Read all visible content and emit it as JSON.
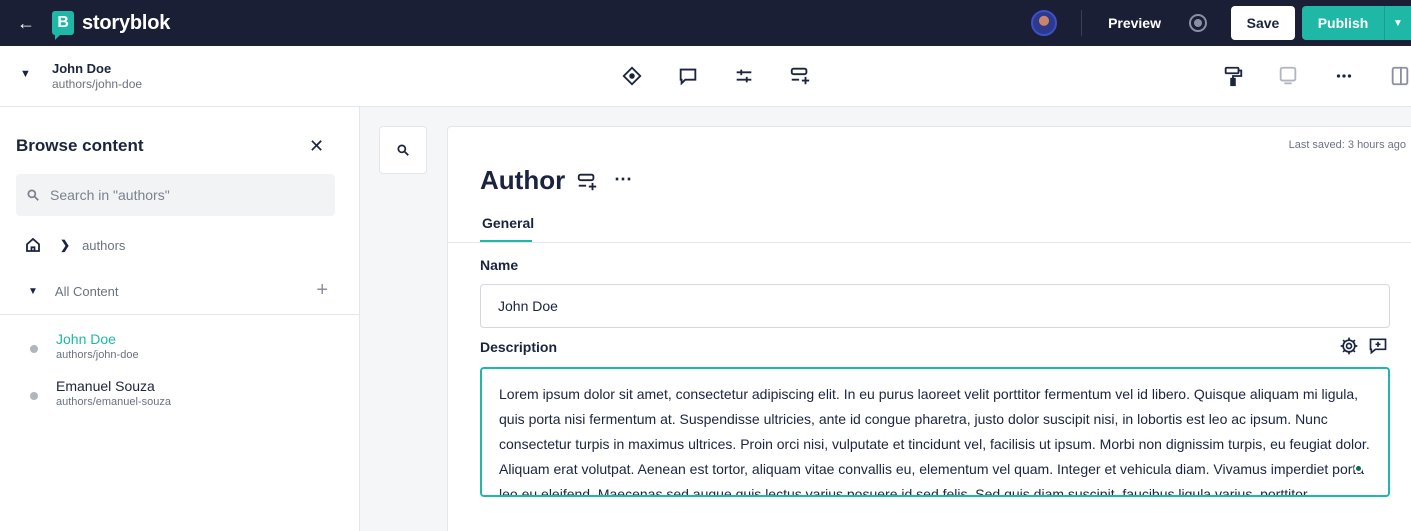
{
  "topbar": {
    "brand": "storyblok",
    "brand_mark": "B",
    "preview_label": "Preview",
    "save_label": "Save",
    "publish_label": "Publish",
    "accent": "#1fb8a6",
    "background": "#1b1f36"
  },
  "story": {
    "title": "John Doe",
    "slug": "authors/john-doe"
  },
  "toolbar_icons": [
    "entry-icon",
    "comments-icon",
    "settings-sliders-icon",
    "components-icon"
  ],
  "right_icons": [
    "paint-roller-icon",
    "device-preview-icon",
    "more-icon",
    "sidebar-toggle-icon"
  ],
  "sidebar": {
    "title": "Browse content",
    "search_placeholder": "Search in \"authors\"",
    "breadcrumb": "authors",
    "all_content_label": "All Content",
    "items": [
      {
        "title": "John Doe",
        "slug": "authors/john-doe",
        "active": true
      },
      {
        "title": "Emanuel Souza",
        "slug": "authors/emanuel-souza",
        "active": false
      }
    ]
  },
  "editor": {
    "last_saved": "Last saved: 3 hours ago",
    "component_title": "Author",
    "tab_general": "General",
    "name_label": "Name",
    "name_value": "John Doe",
    "description_label": "Description",
    "description_value": "Lorem ipsum dolor sit amet, consectetur adipiscing elit. In eu purus laoreet velit porttitor fermentum vel id libero. Quisque aliquam mi ligula, quis porta nisi fermentum at. Suspendisse ultricies, ante id congue pharetra, justo dolor suscipit nisi, in lobortis est leo ac ipsum. Nunc consectetur turpis in maximus ultrices. Proin orci nisi, vulputate et tincidunt vel, facilisis ut ipsum. Morbi non dignissim turpis, eu feugiat dolor. Aliquam erat volutpat. Aenean est tortor, aliquam vitae convallis eu, elementum vel quam. Integer et vehicula diam. Vivamus imperdiet porta leo eu eleifend. Maecenas sed augue quis lectus varius posuere id sed felis. Sed quis diam suscipit, faucibus ligula varius, porttitor"
  }
}
